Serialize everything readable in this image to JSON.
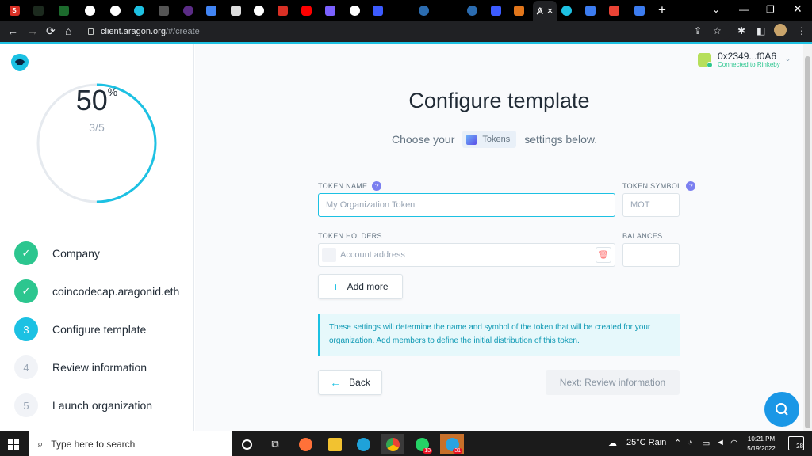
{
  "browser": {
    "url_host": "client.aragon.org",
    "url_path": "/#/create",
    "active_tab_label": "Ⱥ",
    "close_glyph": "×",
    "new_tab_glyph": "+",
    "back_glyph": "←",
    "forward_glyph": "→",
    "reload_glyph": "⟳",
    "home_glyph": "⌂"
  },
  "account": {
    "address": "0x2349...f0A6",
    "network": "Connected to Rinkeby"
  },
  "progress": {
    "percent_value": 50,
    "percent": "50",
    "percent_symbol": "%",
    "fraction": "3/5"
  },
  "steps": [
    {
      "number": "✓",
      "label": "Company",
      "state": "done"
    },
    {
      "number": "✓",
      "label": "coincodecap.aragonid.eth",
      "state": "done"
    },
    {
      "number": "3",
      "label": "Configure template",
      "state": "current"
    },
    {
      "number": "4",
      "label": "Review information",
      "state": "todo"
    },
    {
      "number": "5",
      "label": "Launch organization",
      "state": "todo"
    }
  ],
  "main": {
    "title": "Configure template",
    "subtitle_before": "Choose your",
    "template_badge": "Tokens",
    "subtitle_after": "settings below.",
    "token_name_label": "TOKEN NAME",
    "token_name_placeholder": "My Organization Token",
    "token_symbol_label": "TOKEN SYMBOL",
    "token_symbol_placeholder": "MOT",
    "holders_label": "TOKEN HOLDERS",
    "holder_placeholder": "Account address",
    "balances_label": "BALANCES",
    "help_glyph": "?",
    "add_more_label": "Add more",
    "info_text": "These settings will determine the name and symbol of the token that will be created for your organization. Add members to define the initial distribution of this token.",
    "back_label": "Back",
    "next_label": "Next: Review information"
  },
  "taskbar": {
    "search_placeholder": "Type here to search",
    "whatsapp_badge": "13",
    "telegram_badge": "31",
    "weather": "25°C  Rain",
    "time": "10:21 PM",
    "date": "5/19/2022",
    "notifications": "28"
  },
  "colors": {
    "accent": "#1cc1e3",
    "done": "#2cc68f",
    "ring_track": "#e6eaef",
    "fab": "#1a97e6"
  }
}
